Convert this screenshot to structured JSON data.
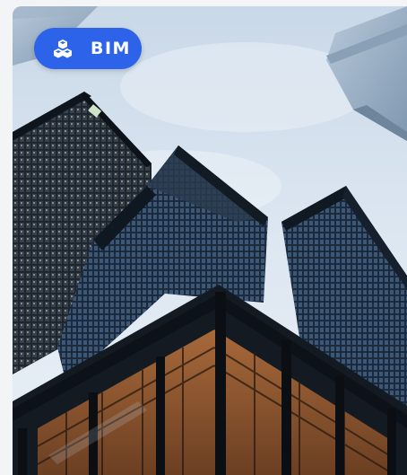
{
  "badge": {
    "label": "BIM",
    "icon": "cubes-icon",
    "color": "#2d63e8"
  }
}
